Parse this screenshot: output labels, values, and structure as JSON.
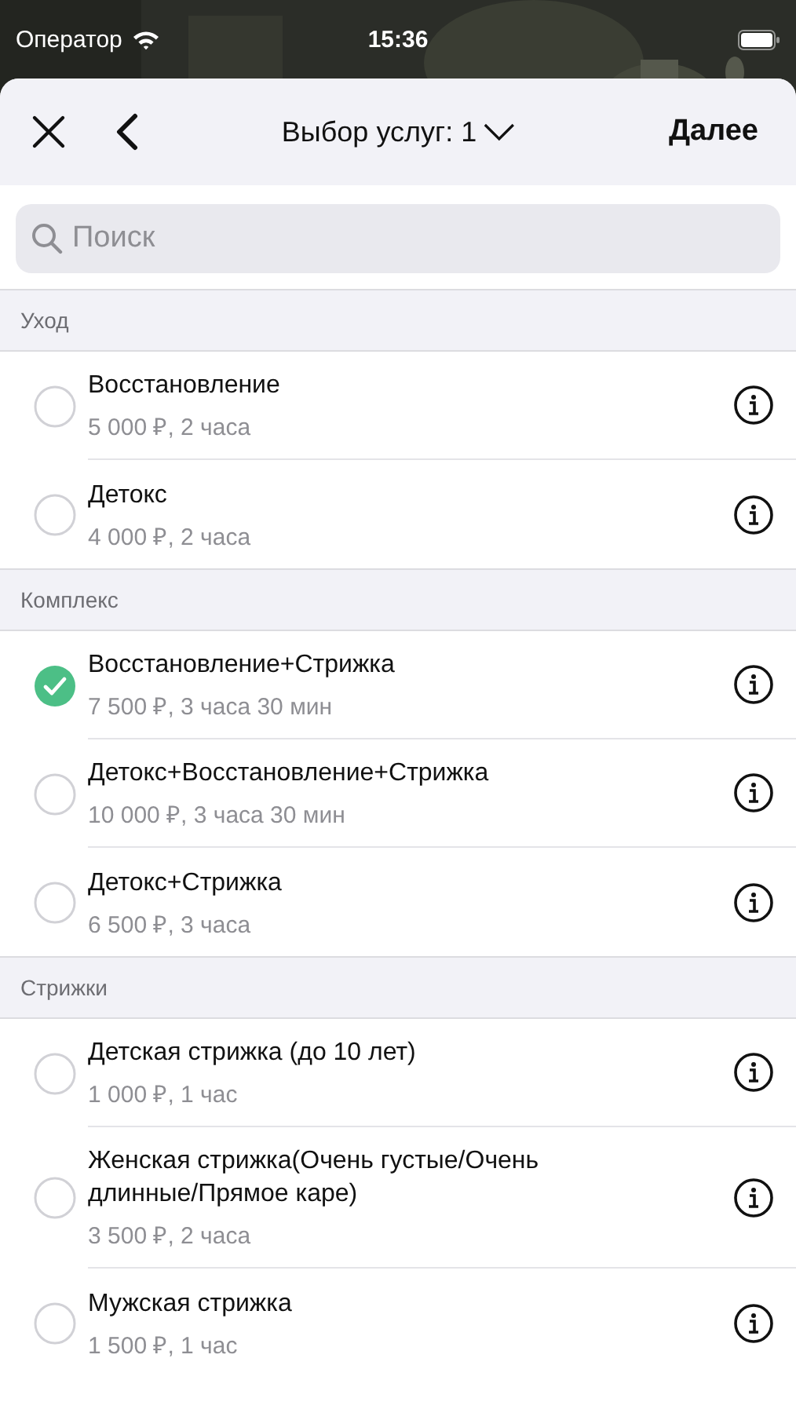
{
  "status_bar": {
    "carrier": "Оператор",
    "time": "15:36"
  },
  "header": {
    "title": "Выбор услуг: 1",
    "next": "Далее"
  },
  "search": {
    "placeholder": "Поиск"
  },
  "sections": [
    {
      "title": "Уход",
      "items": [
        {
          "name": "Восстановление",
          "details": "5 000 ₽, 2 часа",
          "selected": false
        },
        {
          "name": "Детокс",
          "details": "4 000 ₽, 2 часа",
          "selected": false
        }
      ]
    },
    {
      "title": "Комплекс",
      "items": [
        {
          "name": "Восстановление+Стрижка",
          "details": "7 500 ₽, 3 часа 30 мин",
          "selected": true
        },
        {
          "name": "Детокс+Восстановление+Стрижка",
          "details": "10 000 ₽, 3 часа 30 мин",
          "selected": false
        },
        {
          "name": "Детокс+Стрижка",
          "details": "6 500 ₽, 3 часа",
          "selected": false
        }
      ]
    },
    {
      "title": "Стрижки",
      "items": [
        {
          "name": "Детская стрижка (до 10 лет)",
          "details": "1 000 ₽, 1 час",
          "selected": false
        },
        {
          "name": "Женская стрижка(Очень густые/Очень длинные/Прямое каре)",
          "details": "3 500 ₽, 2 часа",
          "selected": false
        },
        {
          "name": "Мужская стрижка",
          "details": "1 500 ₽, 1 час",
          "selected": false
        }
      ]
    }
  ]
}
